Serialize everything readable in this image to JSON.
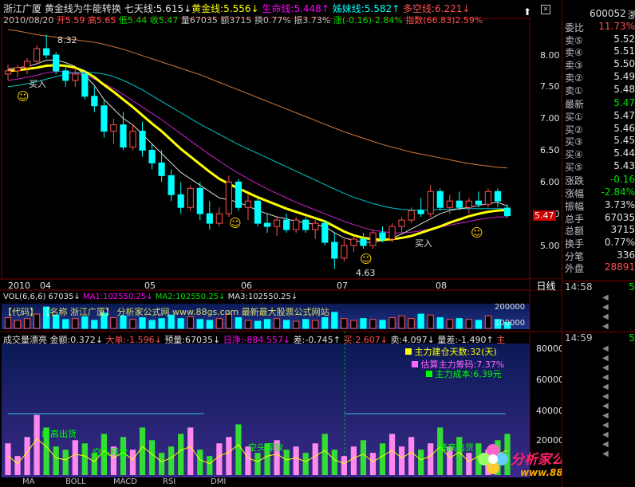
{
  "header": {
    "stock_name": "浙江广厦",
    "indicator_name": "黄金线为牛能转换",
    "qitian_label": "七天线:5.615↓",
    "huangjin_label": "黄金线:5.556↓",
    "shengming_label": "生命线:5.448↑",
    "jiemei_label": "姊妹线:5.582↑",
    "duokong_label": "多空线:6.221↓",
    "date": "2010/08/20",
    "open": "开5.59",
    "high": "高5.65",
    "low": "低5.44",
    "close": "收5.47",
    "volume": "量67035",
    "amount": "额3715",
    "turnover": "换0.77%",
    "amplitude": "振3.73%",
    "change": "涨(-0.16)-2.84%",
    "index": "指数(66.83)2.59%"
  },
  "annotations": {
    "high_label": "8.32",
    "low_label": "4.63",
    "buy1": "买入",
    "buy2": "买入",
    "current_price": "5.47"
  },
  "price_axis": {
    "ticks": [
      "8.00",
      "7.50",
      "7.00",
      "6.50",
      "6.00",
      "5.50",
      "5.00"
    ]
  },
  "time_axis": {
    "labels": [
      "2010",
      "04",
      "05",
      "06",
      "07",
      "08"
    ],
    "period_button": "日线"
  },
  "vol_panel": {
    "title": "VOL(6,6,6)",
    "vol": "67035↓",
    "ma1": "MA1:102550.25↓",
    "ma2": "MA2:102550.25↓",
    "ma3": "MA3:102550.25↓",
    "axis": [
      "200000",
      "100000"
    ],
    "watermark": "【代码】 【名称 浙江广厦】  分析家公式网 www.88gs.com 最新最大股票公式网站"
  },
  "money_panel": {
    "title": "成交量漂亮",
    "amount": "金额:0.372↓",
    "big_order": "大单:-1.596↓",
    "est_vol": "预量:67035↓",
    "net_day": "日净:-884.557↓",
    "diff": "差:-0.745↑",
    "buy": "买:2.607↓",
    "sell": "卖:4.097↓",
    "volume_diff": "量差:-1.490↑",
    "main": "主",
    "legend1": "主力建仓天数:32(天)",
    "legend2": "估算主力筹码:7.37%",
    "legend3": "主力成本:6.39元",
    "axis": [
      "80000",
      "60000",
      "40000",
      "20000"
    ],
    "tags": [
      "峰高出货",
      "空头释放",
      "空头释放",
      "峰高出货"
    ]
  },
  "bottom_tabs": [
    "MA",
    "BOLL",
    "MACD",
    "RSI",
    "DMI"
  ],
  "logo": {
    "name": "分析家公式网",
    "url": "www.88gs.com"
  },
  "right_panel": {
    "code": "600052",
    "name_cut": "浙",
    "rows": [
      {
        "label": "委比",
        "value": "11.73%",
        "color": "#ff5050"
      },
      {
        "label": "卖⑤",
        "value": "5.52",
        "color": "#e0e0e0"
      },
      {
        "label": "卖④",
        "value": "5.51",
        "color": "#e0e0e0"
      },
      {
        "label": "卖③",
        "value": "5.50",
        "color": "#e0e0e0"
      },
      {
        "label": "卖②",
        "value": "5.49",
        "color": "#e0e0e0"
      },
      {
        "label": "卖①",
        "value": "5.48",
        "color": "#e0e0e0"
      },
      {
        "label": "最新",
        "value": "5.47",
        "color": "#00e000"
      },
      {
        "label": "买①",
        "value": "5.47",
        "color": "#e0e0e0"
      },
      {
        "label": "买②",
        "value": "5.46",
        "color": "#e0e0e0"
      },
      {
        "label": "买③",
        "value": "5.45",
        "color": "#e0e0e0"
      },
      {
        "label": "买④",
        "value": "5.44",
        "color": "#e0e0e0"
      },
      {
        "label": "买⑤",
        "value": "5.43",
        "color": "#e0e0e0"
      },
      {
        "label": "涨跌",
        "value": "-0.16",
        "color": "#00e000"
      },
      {
        "label": "涨幅",
        "value": "-2.84%",
        "color": "#00e000"
      },
      {
        "label": "振幅",
        "value": "3.73%",
        "color": "#e0e0e0"
      },
      {
        "label": "总手",
        "value": "67035",
        "color": "#e0e0e0"
      },
      {
        "label": "总额",
        "value": "3715",
        "color": "#e0e0e0"
      },
      {
        "label": "换手",
        "value": "0.77%",
        "color": "#e0e0e0"
      },
      {
        "label": "分笔",
        "value": "336",
        "color": "#e0e0e0"
      },
      {
        "label": "外盘",
        "value": "28891",
        "color": "#ff5050"
      }
    ],
    "ticks": [
      {
        "time": "14:58",
        "price": "5",
        "color": "#00e000"
      },
      {
        "time": "14:59",
        "price": "5",
        "color": "#00e000"
      }
    ]
  },
  "colors": {
    "up": "#ff5050",
    "down": "#00ffff",
    "gold": "#ffff00",
    "bg": "#000000",
    "grid": "#7a0000"
  },
  "chart_data": {
    "type": "candlestick",
    "y_range": [
      4.5,
      8.5
    ],
    "candles": [
      {
        "o": 7.7,
        "h": 7.85,
        "l": 7.6,
        "c": 7.75
      },
      {
        "o": 7.75,
        "h": 7.85,
        "l": 7.65,
        "c": 7.8
      },
      {
        "o": 7.8,
        "h": 7.95,
        "l": 7.7,
        "c": 7.9
      },
      {
        "o": 7.9,
        "h": 8.15,
        "l": 7.85,
        "c": 8.1
      },
      {
        "o": 8.1,
        "h": 8.32,
        "l": 7.95,
        "c": 8.0
      },
      {
        "o": 8.0,
        "h": 8.05,
        "l": 7.7,
        "c": 7.75
      },
      {
        "o": 7.75,
        "h": 7.85,
        "l": 7.5,
        "c": 7.6
      },
      {
        "o": 7.6,
        "h": 7.8,
        "l": 7.5,
        "c": 7.7
      },
      {
        "o": 7.7,
        "h": 7.75,
        "l": 7.3,
        "c": 7.35
      },
      {
        "o": 7.35,
        "h": 7.5,
        "l": 7.1,
        "c": 7.2
      },
      {
        "o": 7.2,
        "h": 7.3,
        "l": 6.7,
        "c": 6.8
      },
      {
        "o": 6.8,
        "h": 7.0,
        "l": 6.6,
        "c": 6.9
      },
      {
        "o": 6.9,
        "h": 7.1,
        "l": 6.5,
        "c": 6.55
      },
      {
        "o": 6.55,
        "h": 6.9,
        "l": 6.5,
        "c": 6.8
      },
      {
        "o": 6.8,
        "h": 6.95,
        "l": 6.4,
        "c": 6.5
      },
      {
        "o": 6.5,
        "h": 6.6,
        "l": 6.2,
        "c": 6.3
      },
      {
        "o": 6.3,
        "h": 6.5,
        "l": 6.0,
        "c": 6.1
      },
      {
        "o": 6.1,
        "h": 6.2,
        "l": 5.7,
        "c": 5.8
      },
      {
        "o": 5.8,
        "h": 6.0,
        "l": 5.5,
        "c": 5.6
      },
      {
        "o": 5.6,
        "h": 5.95,
        "l": 5.55,
        "c": 5.9
      },
      {
        "o": 5.9,
        "h": 6.0,
        "l": 5.4,
        "c": 5.5
      },
      {
        "o": 5.5,
        "h": 5.7,
        "l": 5.25,
        "c": 5.35
      },
      {
        "o": 5.35,
        "h": 5.6,
        "l": 5.3,
        "c": 5.5
      },
      {
        "o": 5.5,
        "h": 6.1,
        "l": 5.45,
        "c": 6.0
      },
      {
        "o": 6.0,
        "h": 6.05,
        "l": 5.55,
        "c": 5.6
      },
      {
        "o": 5.6,
        "h": 5.8,
        "l": 5.4,
        "c": 5.7
      },
      {
        "o": 5.7,
        "h": 5.75,
        "l": 5.3,
        "c": 5.35
      },
      {
        "o": 5.35,
        "h": 5.5,
        "l": 5.2,
        "c": 5.3
      },
      {
        "o": 5.3,
        "h": 5.45,
        "l": 5.15,
        "c": 5.4
      },
      {
        "o": 5.4,
        "h": 5.5,
        "l": 5.2,
        "c": 5.25
      },
      {
        "o": 5.25,
        "h": 5.45,
        "l": 5.2,
        "c": 5.4
      },
      {
        "o": 5.4,
        "h": 5.45,
        "l": 5.2,
        "c": 5.25
      },
      {
        "o": 5.25,
        "h": 5.4,
        "l": 5.1,
        "c": 5.35
      },
      {
        "o": 5.35,
        "h": 5.4,
        "l": 5.0,
        "c": 5.05
      },
      {
        "o": 5.05,
        "h": 5.2,
        "l": 4.63,
        "c": 4.8
      },
      {
        "o": 4.8,
        "h": 5.1,
        "l": 4.75,
        "c": 5.0
      },
      {
        "o": 5.0,
        "h": 5.15,
        "l": 4.9,
        "c": 5.1
      },
      {
        "o": 5.1,
        "h": 5.2,
        "l": 4.95,
        "c": 5.0
      },
      {
        "o": 5.0,
        "h": 5.25,
        "l": 4.95,
        "c": 5.2
      },
      {
        "o": 5.2,
        "h": 5.3,
        "l": 5.05,
        "c": 5.1
      },
      {
        "o": 5.1,
        "h": 5.35,
        "l": 5.05,
        "c": 5.3
      },
      {
        "o": 5.3,
        "h": 5.45,
        "l": 5.2,
        "c": 5.4
      },
      {
        "o": 5.4,
        "h": 5.6,
        "l": 5.35,
        "c": 5.55
      },
      {
        "o": 5.55,
        "h": 5.75,
        "l": 5.45,
        "c": 5.5
      },
      {
        "o": 5.5,
        "h": 5.95,
        "l": 5.45,
        "c": 5.85
      },
      {
        "o": 5.85,
        "h": 5.9,
        "l": 5.55,
        "c": 5.6
      },
      {
        "o": 5.6,
        "h": 5.8,
        "l": 5.5,
        "c": 5.7
      },
      {
        "o": 5.7,
        "h": 5.85,
        "l": 5.55,
        "c": 5.6
      },
      {
        "o": 5.6,
        "h": 5.75,
        "l": 5.5,
        "c": 5.7
      },
      {
        "o": 5.7,
        "h": 5.85,
        "l": 5.6,
        "c": 5.65
      },
      {
        "o": 5.65,
        "h": 5.9,
        "l": 5.6,
        "c": 5.85
      },
      {
        "o": 5.85,
        "h": 5.9,
        "l": 5.6,
        "c": 5.7
      },
      {
        "o": 5.59,
        "h": 5.65,
        "l": 5.44,
        "c": 5.47
      }
    ],
    "lines": {
      "qitian": [
        7.78,
        7.8,
        7.82,
        7.86,
        7.92,
        7.92,
        7.88,
        7.82,
        7.68,
        7.52,
        7.3,
        7.15,
        7.0,
        6.9,
        6.75,
        6.6,
        6.45,
        6.3,
        6.15,
        6.05,
        5.95,
        5.85,
        5.75,
        5.72,
        5.68,
        5.62,
        5.55,
        5.5,
        5.45,
        5.42,
        5.38,
        5.36,
        5.33,
        5.3,
        5.2,
        5.12,
        5.08,
        5.05,
        5.05,
        5.08,
        5.12,
        5.18,
        5.26,
        5.34,
        5.42,
        5.5,
        5.55,
        5.58,
        5.6,
        5.63,
        5.66,
        5.68,
        5.62
      ],
      "huangjin": [
        7.75,
        7.76,
        7.78,
        7.8,
        7.83,
        7.84,
        7.83,
        7.8,
        7.74,
        7.65,
        7.53,
        7.42,
        7.3,
        7.18,
        7.05,
        6.92,
        6.8,
        6.66,
        6.52,
        6.4,
        6.28,
        6.16,
        6.05,
        5.97,
        5.9,
        5.83,
        5.76,
        5.7,
        5.64,
        5.58,
        5.53,
        5.48,
        5.43,
        5.38,
        5.3,
        5.22,
        5.16,
        5.12,
        5.1,
        5.09,
        5.1,
        5.12,
        5.15,
        5.2,
        5.25,
        5.3,
        5.36,
        5.41,
        5.46,
        5.5,
        5.53,
        5.55,
        5.56
      ],
      "shengming": [
        7.6,
        7.62,
        7.65,
        7.68,
        7.72,
        7.74,
        7.74,
        7.72,
        7.68,
        7.62,
        7.55,
        7.47,
        7.38,
        7.28,
        7.18,
        7.08,
        6.98,
        6.87,
        6.76,
        6.65,
        6.54,
        6.43,
        6.33,
        6.23,
        6.14,
        6.05,
        5.97,
        5.89,
        5.82,
        5.75,
        5.68,
        5.62,
        5.56,
        5.5,
        5.44,
        5.38,
        5.33,
        5.28,
        5.24,
        5.22,
        5.2,
        5.2,
        5.21,
        5.23,
        5.26,
        5.29,
        5.32,
        5.35,
        5.38,
        5.41,
        5.43,
        5.45,
        5.45
      ],
      "jiemei": [
        7.5,
        7.52,
        7.55,
        7.58,
        7.62,
        7.66,
        7.7,
        7.72,
        7.73,
        7.72,
        7.7,
        7.66,
        7.6,
        7.53,
        7.45,
        7.36,
        7.27,
        7.18,
        7.09,
        7.0,
        6.91,
        6.83,
        6.75,
        6.67,
        6.59,
        6.52,
        6.45,
        6.38,
        6.31,
        6.24,
        6.17,
        6.1,
        6.03,
        5.96,
        5.89,
        5.82,
        5.76,
        5.71,
        5.66,
        5.62,
        5.59,
        5.57,
        5.56,
        5.56,
        5.56,
        5.57,
        5.57,
        5.58,
        5.58,
        5.58,
        5.58,
        5.58,
        5.58
      ],
      "duokong": [
        8.4,
        8.38,
        8.35,
        8.32,
        8.3,
        8.28,
        8.26,
        8.24,
        8.22,
        8.2,
        8.17,
        8.13,
        8.09,
        8.04,
        7.99,
        7.94,
        7.89,
        7.84,
        7.79,
        7.74,
        7.69,
        7.63,
        7.57,
        7.51,
        7.45,
        7.39,
        7.33,
        7.27,
        7.21,
        7.15,
        7.09,
        7.03,
        6.97,
        6.91,
        6.85,
        6.79,
        6.74,
        6.69,
        6.64,
        6.59,
        6.55,
        6.51,
        6.47,
        6.44,
        6.41,
        6.38,
        6.35,
        6.32,
        6.29,
        6.27,
        6.25,
        6.23,
        6.22
      ]
    },
    "volumes": [
      120000,
      90000,
      110000,
      160000,
      240000,
      150000,
      100000,
      110000,
      130000,
      90000,
      170000,
      120000,
      140000,
      100000,
      120000,
      90000,
      110000,
      150000,
      110000,
      130000,
      100000,
      90000,
      110000,
      160000,
      120000,
      90000,
      80000,
      100000,
      110000,
      90000,
      80000,
      100000,
      90000,
      120000,
      180000,
      110000,
      90000,
      110000,
      100000,
      90000,
      120000,
      140000,
      110000,
      160000,
      150000,
      120000,
      100000,
      110000,
      100000,
      90000,
      140000,
      100000,
      67035
    ],
    "money": [
      20000,
      12000,
      24000,
      38000,
      30000,
      18000,
      16000,
      22000,
      20000,
      14000,
      26000,
      18000,
      24000,
      16000,
      30000,
      22000,
      14000,
      18000,
      26000,
      30000,
      16000,
      12000,
      20000,
      24000,
      32000,
      18000,
      14000,
      20000,
      22000,
      16000,
      18000,
      14000,
      20000,
      26000,
      16000,
      12000,
      18000,
      22000,
      14000,
      20000,
      26000,
      18000,
      24000,
      16000,
      20000,
      30000,
      18000,
      24000,
      14000,
      20000,
      16000,
      22000,
      26000
    ]
  }
}
